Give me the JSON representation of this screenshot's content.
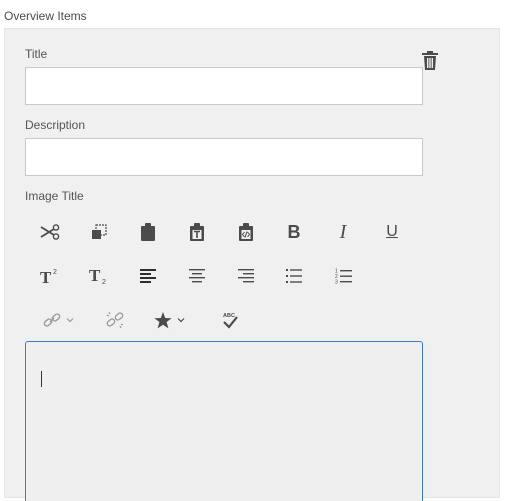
{
  "section": {
    "title": "Overview Items"
  },
  "fields": {
    "title_label": "Title",
    "title_value": "",
    "description_label": "Description",
    "description_value": "",
    "image_title_label": "Image Title"
  },
  "toolbar": {
    "rows": [
      [
        "scissors-icon",
        "copy-icon",
        "paste-icon",
        "paste-text-icon",
        "paste-word-icon",
        "bold",
        "italic",
        "underline"
      ],
      [
        "superscript",
        "subscript",
        "align-left",
        "align-center",
        "align-right",
        "bulleted-list",
        "numbered-list"
      ],
      [
        "link-dropdown",
        "unlink",
        "star-dropdown",
        "spellcheck"
      ]
    ],
    "bold_glyph": "B",
    "italic_glyph": "I",
    "underline_glyph": "U"
  },
  "colors": {
    "panel_bg": "#f0f0f0",
    "focus_border": "#3b7bd6",
    "icon": "#4b4b4b",
    "disabled_icon": "#9a9a9a"
  }
}
